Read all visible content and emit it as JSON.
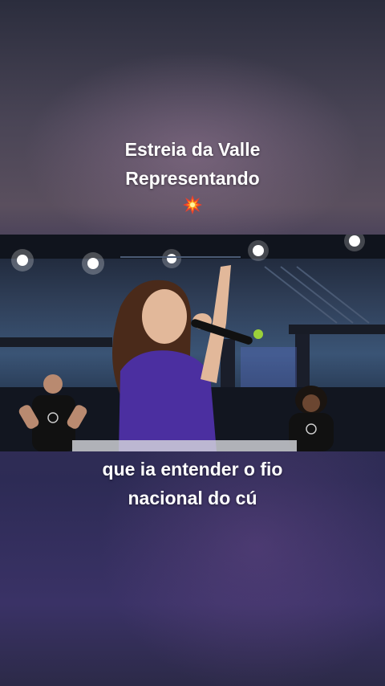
{
  "overlay_top": {
    "line1": "Estreia da Valle",
    "line2": "Representando",
    "emoji_icon": "collision-emoji"
  },
  "video_frame": {
    "scene": "singer-with-microphone-in-mma-cage",
    "accent_shirt_color": "#4b2fa0"
  },
  "overlay_bottom": {
    "line1": "que ia entender o fio",
    "line2": "nacional do cú"
  }
}
